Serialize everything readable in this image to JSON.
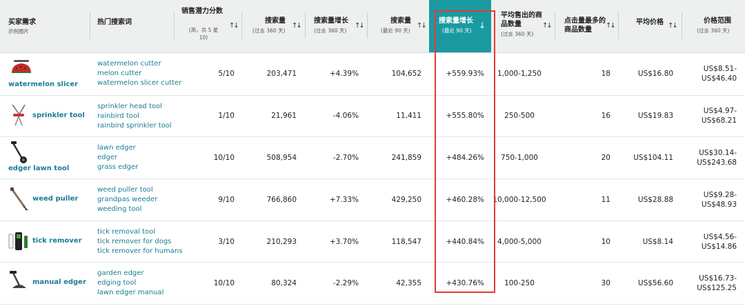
{
  "columns": {
    "demand": {
      "title": "买家需求",
      "sub": "示例图片"
    },
    "keywords": {
      "title": "热门搜索词"
    },
    "potential": {
      "title": "销售潜力分数",
      "sub": "(高，共 5 星 10)",
      "sort": "↑↓"
    },
    "volume360": {
      "title": "搜索量",
      "sub": "(过去 360 天)",
      "sort": "↑↓"
    },
    "growth360": {
      "title": "搜索量增长",
      "sub": "(过去 360 天)",
      "sort": "↑↓"
    },
    "volume90": {
      "title": "搜索量",
      "sub": "(最近 90 天)",
      "sort": "↑↓"
    },
    "growth90": {
      "title": "搜索量增长",
      "sub": "(最近 90 天)",
      "sort": "↓"
    },
    "avgSold": {
      "title": "平均售出的商品数量",
      "sub": "(过去 360 天)",
      "sort": "↑↓"
    },
    "clicked": {
      "title": "点击量最多的商品数量",
      "sort": "↑↓"
    },
    "avgPrice": {
      "title": "平均价格",
      "sort": "↑↓"
    },
    "priceRange": {
      "title": "价格范围",
      "sub": "(过去 360 天)"
    }
  },
  "rows": [
    {
      "name": "watermelon slicer",
      "icon": "watermelon-slicer-icon",
      "keywords": [
        "watermelon cutter",
        "melon cutter",
        "watermelon slicer cutter"
      ],
      "potential": "5/10",
      "volume360": "203,471",
      "growth360": "+4.39%",
      "volume90": "104,652",
      "growth90": "+559.93%",
      "avgSold": "1,000-1,250",
      "clicked": "18",
      "avgPrice": "US$16.80",
      "priceLow": "US$8.51-",
      "priceHigh": "US$46.40"
    },
    {
      "name": "sprinkler tool",
      "icon": "sprinkler-tool-icon",
      "keywords": [
        "sprinkler head tool",
        "rainbird tool",
        "rainbird sprinkler tool"
      ],
      "potential": "1/10",
      "volume360": "21,961",
      "growth360": "-4.06%",
      "volume90": "11,411",
      "growth90": "+555.80%",
      "avgSold": "250-500",
      "clicked": "16",
      "avgPrice": "US$19.83",
      "priceLow": "US$4.97-",
      "priceHigh": "US$68.21"
    },
    {
      "name": "edger lawn tool",
      "icon": "edger-lawn-tool-icon",
      "keywords": [
        "lawn edger",
        "edger",
        "grass edger"
      ],
      "potential": "10/10",
      "volume360": "508,954",
      "growth360": "-2.70%",
      "volume90": "241,859",
      "growth90": "+484.26%",
      "avgSold": "750-1,000",
      "clicked": "20",
      "avgPrice": "US$104.11",
      "priceLow": "US$30.14-",
      "priceHigh": "US$243.68"
    },
    {
      "name": "weed puller",
      "icon": "weed-puller-icon",
      "keywords": [
        "weed puller tool",
        "grandpas weeder",
        "weeding tool"
      ],
      "potential": "9/10",
      "volume360": "766,860",
      "growth360": "+7.33%",
      "volume90": "429,250",
      "growth90": "+460.28%",
      "avgSold": "10,000-12,500",
      "clicked": "11",
      "avgPrice": "US$28.88",
      "priceLow": "US$9.28-",
      "priceHigh": "US$48.93"
    },
    {
      "name": "tick remover",
      "icon": "tick-remover-icon",
      "keywords": [
        "tick removal tool",
        "tick remover for dogs",
        "tick remover for humans"
      ],
      "potential": "3/10",
      "volume360": "210,293",
      "growth360": "+3.70%",
      "volume90": "118,547",
      "growth90": "+440.84%",
      "avgSold": "4,000-5,000",
      "clicked": "10",
      "avgPrice": "US$8.14",
      "priceLow": "US$4.56-",
      "priceHigh": "US$14.86"
    },
    {
      "name": "manual edger",
      "icon": "manual-edger-icon",
      "keywords": [
        "garden edger",
        "edging tool",
        "lawn edger manual"
      ],
      "potential": "10/10",
      "volume360": "80,324",
      "growth360": "-2.29%",
      "volume90": "42,355",
      "growth90": "+430.76%",
      "avgSold": "100-250",
      "clicked": "30",
      "avgPrice": "US$56.60",
      "priceLow": "US$16.73-",
      "priceHigh": "US$125.25"
    }
  ],
  "colors": {
    "header_bg": "#eef0f0",
    "active_col": "#1a9aa0",
    "link": "#1a7d95",
    "highlight": "#e53935"
  }
}
